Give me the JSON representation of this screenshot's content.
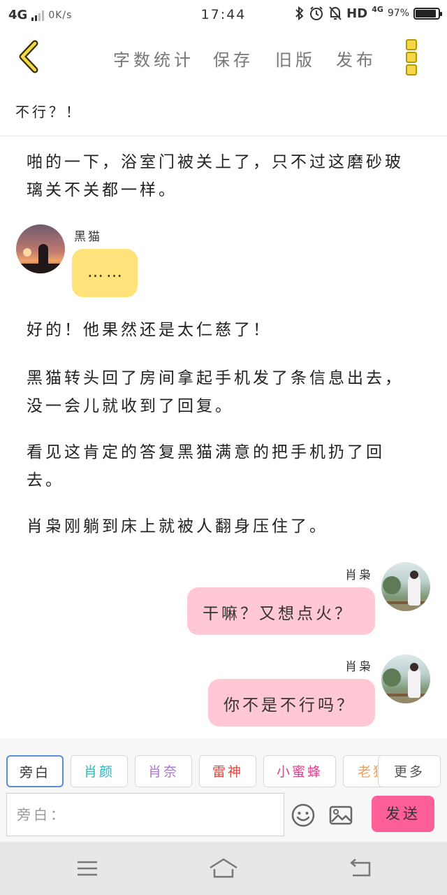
{
  "status_bar": {
    "network": "4G",
    "speed": "0K/s",
    "time": "17:44",
    "hd": "HD",
    "small_network": "4G",
    "battery_percent": "97%",
    "battery_level": 0.97,
    "icons": [
      "bluetooth-icon",
      "alarm-icon",
      "mute-icon"
    ]
  },
  "toolbar": {
    "back_icon": "chevron-left-icon",
    "word_count": "字数统计",
    "save": "保存",
    "old_version": "旧版",
    "publish": "发布",
    "more_icon": "vertical-dots-icon",
    "accent_color": "#f4d84a"
  },
  "chapter_title": "不行？！",
  "content": {
    "para1": "啪的一下，浴室门被关上了，只不过这磨砂玻璃关不关都一样。",
    "msg1": {
      "speaker": "黑猫",
      "text": "……"
    },
    "para2": "好的！他果然还是太仁慈了！",
    "para3": "黑猫转头回了房间拿起手机发了条信息出去，没一会儿就收到了回复。",
    "para4": "看见这肯定的答复黑猫满意的把手机扔了回去。",
    "para5": "肖枭刚躺到床上就被人翻身压住了。",
    "msg2": {
      "speaker": "肖枭",
      "text": "干嘛？又想点火？"
    },
    "msg3": {
      "speaker": "肖枭",
      "text": "你不是不行吗？"
    },
    "bubble_colors": {
      "left": "#ffe27a",
      "right": "#ffc8d4"
    }
  },
  "input_area": {
    "chips": [
      {
        "label": "旁白",
        "color": "#333333"
      },
      {
        "label": "肖颜",
        "color": "#2bb5c3"
      },
      {
        "label": "肖奈",
        "color": "#b071d9"
      },
      {
        "label": "雷神",
        "color": "#e0443b"
      },
      {
        "label": "小蜜蜂",
        "color": "#e0408a"
      },
      {
        "label": "老狐",
        "color": "#f0a058"
      }
    ],
    "more": "更多",
    "placeholder": "旁白：",
    "value": "",
    "emoji_icon": "emoji-icon",
    "image_icon": "image-icon",
    "send": "发送",
    "send_color": "#ff5f98"
  },
  "nav_bar": {
    "icons": [
      "menu-icon",
      "home-icon",
      "back-icon"
    ]
  }
}
